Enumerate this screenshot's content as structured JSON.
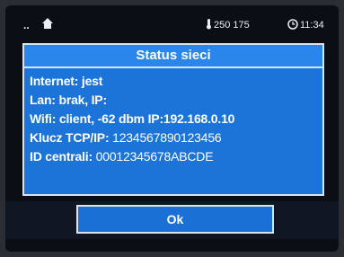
{
  "status_bar": {
    "left_text": "..",
    "temperature": "250 175",
    "time": "11:34"
  },
  "dialog": {
    "title": "Status sieci",
    "lines": [
      {
        "label": "Internet:",
        "value": "jest"
      },
      {
        "label": "Lan:",
        "value": "brak, IP:"
      },
      {
        "label": "Wifi:",
        "value": "client, -62 dbm IP:192.168.0.10"
      },
      {
        "label": "Klucz TCP/IP:",
        "value": "1234567890123456"
      },
      {
        "label": "ID centrali:",
        "value": "00012345678ABCDE"
      }
    ],
    "ok_label": "Ok"
  }
}
